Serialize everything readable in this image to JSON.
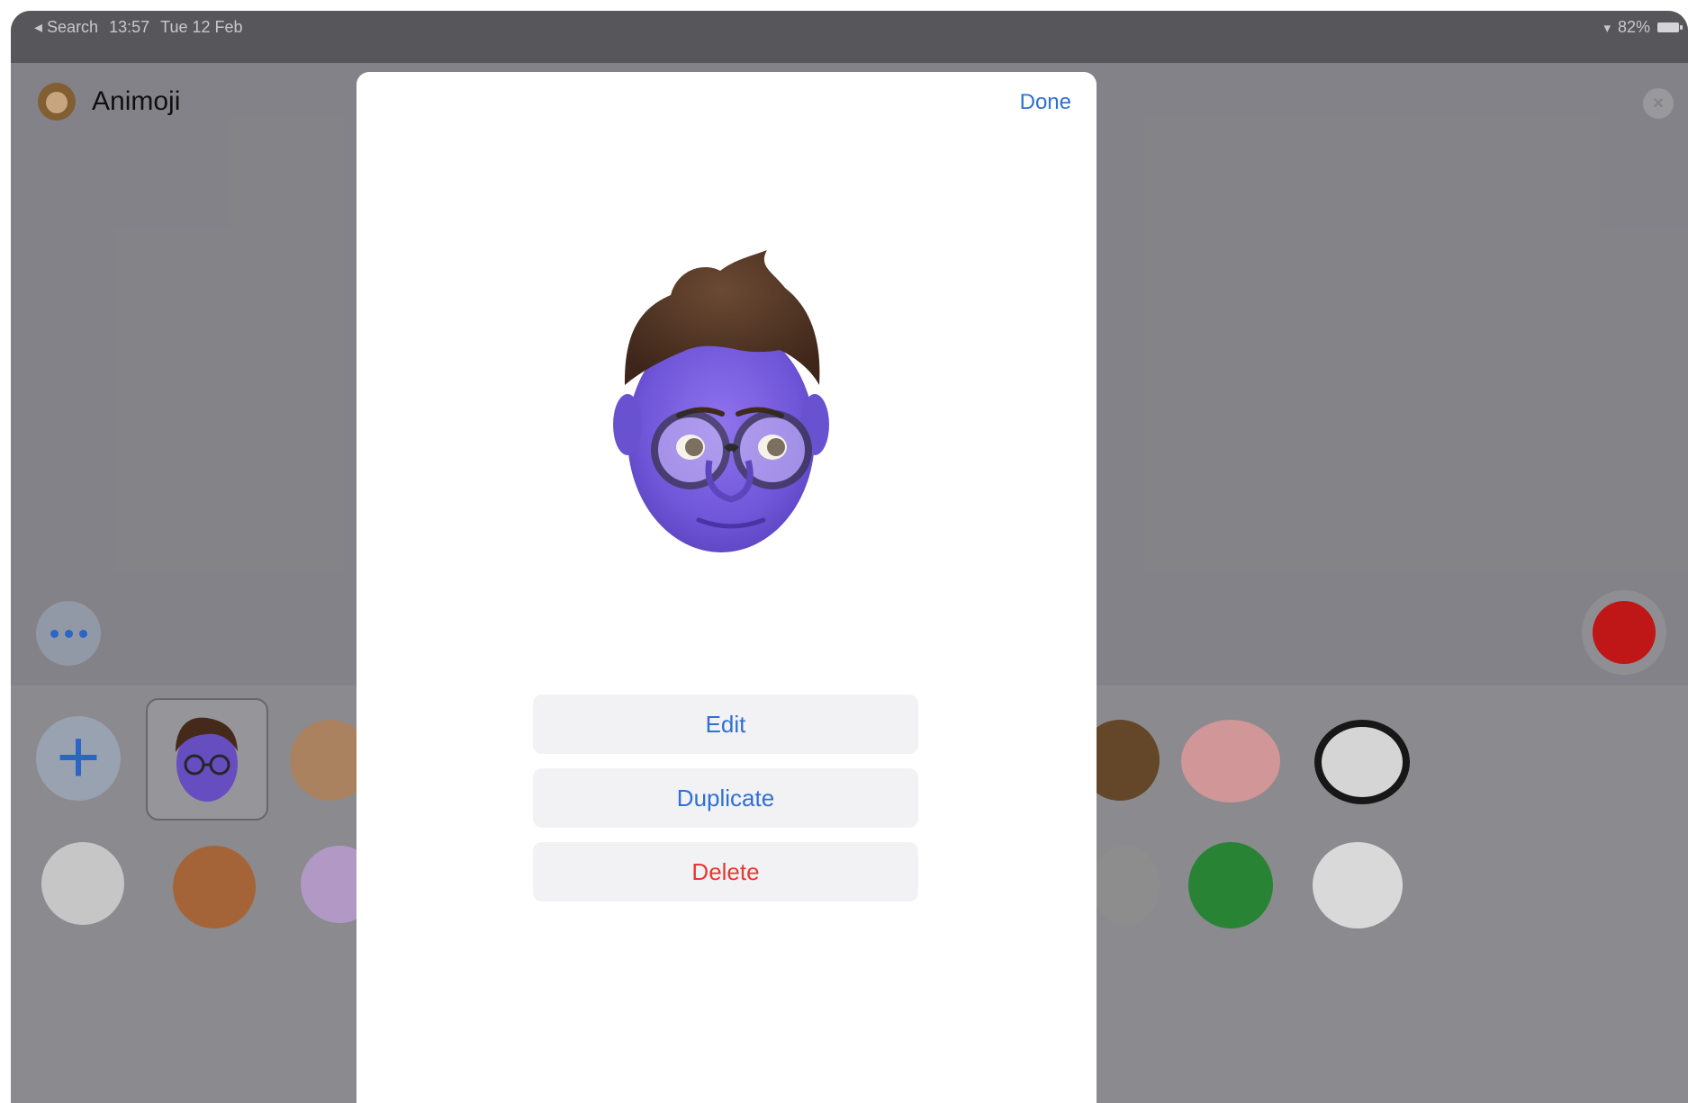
{
  "status_bar": {
    "back_label": "◂ Search",
    "time": "13:57",
    "date": "Tue 12 Feb",
    "battery": "82%"
  },
  "header": {
    "title": "Animoji"
  },
  "sheet": {
    "done_label": "Done",
    "actions": {
      "edit": "Edit",
      "duplicate": "Duplicate",
      "delete": "Delete"
    }
  },
  "colors": {
    "accent": "#2f6fd6",
    "destructive": "#e53935",
    "record": "#d01919",
    "memoji_skin": "#7b5cd6",
    "memoji_hair": "#4a2e1d"
  },
  "icons": {
    "header": "monkey-animoji-icon",
    "close": "close-icon",
    "more": "more-icon",
    "record": "record-icon",
    "add": "plus-icon"
  }
}
